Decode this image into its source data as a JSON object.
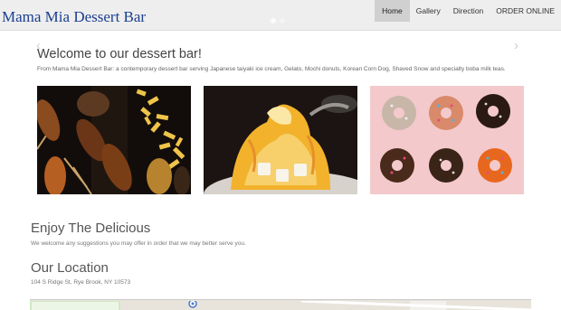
{
  "header": {
    "brand": "Mama Mia Dessert Bar",
    "nav": [
      {
        "label": "Home",
        "active": true
      },
      {
        "label": "Gallery"
      },
      {
        "label": "Direction"
      },
      {
        "label": "ORDER ONLINE"
      }
    ]
  },
  "carousel": {
    "title": "Welcome to our dessert bar!",
    "text": "From Mama Mia Dessert Bar: a contemporary dessert bar serving Japanese taiyaki ice cream, Gelato, Mochi donuts, Korean Corn Dog, Shaved Snow and specialty boba milk teas.",
    "slide_count": 2,
    "active_slide": 1,
    "prev_icon": "chevron-left-icon",
    "next_icon": "chevron-right-icon"
  },
  "enjoy": {
    "title": "Enjoy The Delicious",
    "text": "We welcome any suggestions you may offer in order that we may better serve you."
  },
  "location": {
    "title": "Our Location",
    "address": "104 S Ridge St, Rye Brook, NY 10573"
  },
  "colors": {
    "brand": "#1a3f8f",
    "navbar_bg": "#eeeeee",
    "nav_active_bg": "#d0d0d0",
    "donut_bg": "#f3c9cc"
  }
}
